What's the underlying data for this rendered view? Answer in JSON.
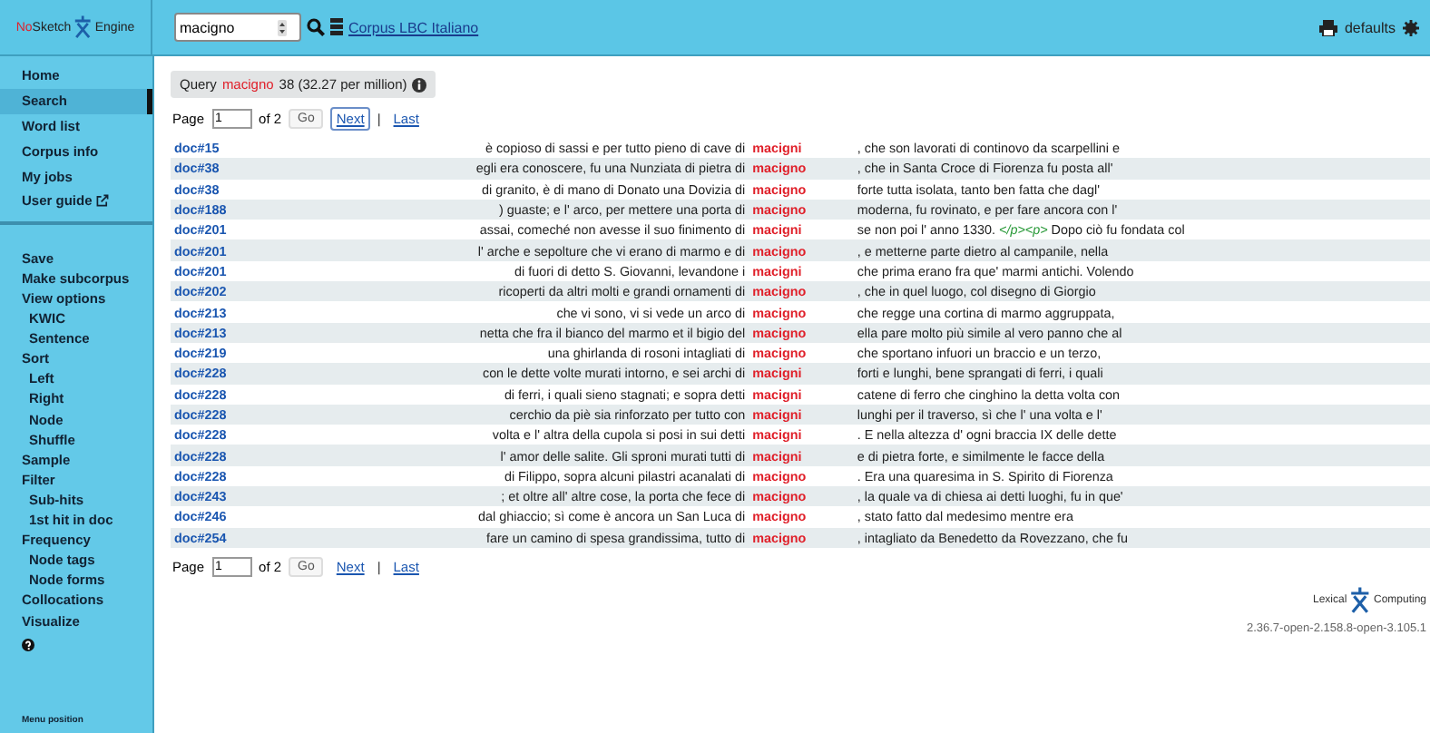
{
  "header": {
    "logo": {
      "prefix": "No",
      "name": "Sketch",
      "suffix": "Engine"
    },
    "search": {
      "value": "macigno"
    },
    "corpus": "Corpus LBC Italiano",
    "user": "defaults"
  },
  "sidebar": {
    "groups": [
      {
        "items": [
          {
            "label": "Home",
            "selected": false
          },
          {
            "label": "Search",
            "selected": true
          },
          {
            "label": "Word list",
            "selected": false
          },
          {
            "label": "Corpus info",
            "selected": false
          },
          {
            "label": "My jobs",
            "selected": false
          },
          {
            "label": "User guide",
            "selected": false,
            "external": true
          }
        ]
      },
      {
        "items": [
          {
            "label": "Save",
            "selected": false
          },
          {
            "label": "Make subcorpus",
            "selected": false
          },
          {
            "label": "View options",
            "selected": false,
            "children": [
              {
                "label": "KWIC",
                "selected": false
              },
              {
                "label": "Sentence",
                "selected": false
              }
            ]
          },
          {
            "label": "Sort",
            "selected": false,
            "children": [
              {
                "label": "Left",
                "selected": false
              },
              {
                "label": "Right",
                "selected": false
              },
              {
                "label": "Node",
                "selected": false
              },
              {
                "label": "Shuffle",
                "selected": false
              }
            ]
          },
          {
            "label": "Sample",
            "selected": false
          },
          {
            "label": "Filter",
            "selected": false,
            "children": [
              {
                "label": "Sub-hits",
                "selected": false
              },
              {
                "label": "1st hit in doc",
                "selected": false
              }
            ]
          },
          {
            "label": "Frequency",
            "selected": false,
            "children": [
              {
                "label": "Node tags",
                "selected": false
              },
              {
                "label": "Node forms",
                "selected": false
              }
            ]
          },
          {
            "label": "Collocations",
            "selected": false
          },
          {
            "label": "Visualize",
            "selected": false
          }
        ]
      }
    ],
    "footer": "Menu position"
  },
  "query": {
    "label": "Query",
    "term": "macigno",
    "count": "38 (32.27 per million)"
  },
  "pagers": [
    {
      "label": "Page",
      "value": "1",
      "of": "of 2",
      "go": "Go",
      "next": "Next",
      "next_focused": true,
      "separator": "|",
      "last": "Last"
    },
    {
      "label": "Page",
      "value": "1",
      "of": "of 2",
      "go": "Go",
      "next": "Next",
      "next_focused": false,
      "separator": "|",
      "last": "Last"
    }
  ],
  "rows": [
    {
      "doc": "doc#15",
      "left": "è copioso di sassi e per tutto pieno di cave di",
      "kwic": "macigni",
      "right": ", che son lavorati di continovo da scarpellini e"
    },
    {
      "doc": "doc#38",
      "left": "egli era conoscere, fu una Nunziata di pietra di",
      "kwic": "macigno",
      "right": ", che in Santa Croce di Fiorenza fu posta all'"
    },
    {
      "doc": "doc#38",
      "left": "di granito, è di mano di Donato una Dovizia di",
      "kwic": "macigno",
      "right": "forte tutta isolata, tanto ben fatta che dagl'"
    },
    {
      "doc": "doc#188",
      "left": ") guaste; e l' arco, per mettere una porta di",
      "kwic": "macigno",
      "right": "moderna, fu rovinato, e per fare ancora con l'"
    },
    {
      "doc": "doc#201",
      "left": "assai, comeché non avesse il suo finimento di",
      "kwic": "macigni",
      "right": "se non poi l' anno 1330.",
      "markup": "</p><p>",
      "right_after": "Dopo ciò fu fondata col"
    },
    {
      "doc": "doc#201",
      "left": "l' arche e sepolture che vi erano di marmo e di",
      "kwic": "macigno",
      "right": ", e metterne parte dietro al campanile, nella"
    },
    {
      "doc": "doc#201",
      "left": "di fuori di detto S. Giovanni, levandone i",
      "kwic": "macigni",
      "right": "che prima erano fra que' marmi antichi. Volendo"
    },
    {
      "doc": "doc#202",
      "left": "ricoperti da altri molti e grandi ornamenti di",
      "kwic": "macigno",
      "right": ", che in quel luogo, col disegno di Giorgio"
    },
    {
      "doc": "doc#213",
      "left": "che vi sono, vi si vede un arco di",
      "kwic": "macigno",
      "right": "che regge una cortina di marmo aggruppata,"
    },
    {
      "doc": "doc#213",
      "left": "netta che fra il bianco del marmo et il bigio del",
      "kwic": "macigno",
      "right": "ella pare molto più simile al vero panno che al"
    },
    {
      "doc": "doc#219",
      "left": "una ghirlanda di rosoni intagliati di",
      "kwic": "macigno",
      "right": "che sportano infuori un braccio e un terzo,"
    },
    {
      "doc": "doc#228",
      "left": "con le dette volte murati intorno, e sei archi di",
      "kwic": "macigni",
      "right": "forti e lunghi, bene sprangati di ferri, i quali"
    },
    {
      "doc": "doc#228",
      "left": "di ferri, i quali sieno stagnati; e sopra detti",
      "kwic": "macigni",
      "right": "catene di ferro che cinghino la detta volta con"
    },
    {
      "doc": "doc#228",
      "left": "cerchio da piè sia rinforzato per tutto con",
      "kwic": "macigni",
      "right": "lunghi per il traverso, sì che l' una volta e l'"
    },
    {
      "doc": "doc#228",
      "left": "volta e l' altra della cupola si posi in sui detti",
      "kwic": "macigni",
      "right": ". E nella altezza d' ogni braccia IX delle dette"
    },
    {
      "doc": "doc#228",
      "left": "l' amor delle salite. Gli sproni murati tutti di",
      "kwic": "macigni",
      "right": "e di pietra forte, e similmente le facce della"
    },
    {
      "doc": "doc#228",
      "left": "di Filippo, sopra alcuni pilastri acanalati di",
      "kwic": "macigno",
      "right": ". Era una quaresima in S. Spirito di Fiorenza"
    },
    {
      "doc": "doc#243",
      "left": "; et oltre all' altre cose, la porta che fece di",
      "kwic": "macigno",
      "right": ", la quale va di chiesa ai detti luoghi, fu in que'"
    },
    {
      "doc": "doc#246",
      "left": "dal ghiaccio; sì come è ancora un San Luca di",
      "kwic": "macigno",
      "right": ", stato fatto dal medesimo mentre era"
    },
    {
      "doc": "doc#254",
      "left": "fare un camino di spesa grandissima, tutto di",
      "kwic": "macigno",
      "right": ", intagliato da Benedetto da Rovezzano, che fu"
    }
  ],
  "brand": {
    "left": "Lexical",
    "right": "Computing",
    "version": "2.36.7-open-2.158.8-open-3.105.1"
  }
}
